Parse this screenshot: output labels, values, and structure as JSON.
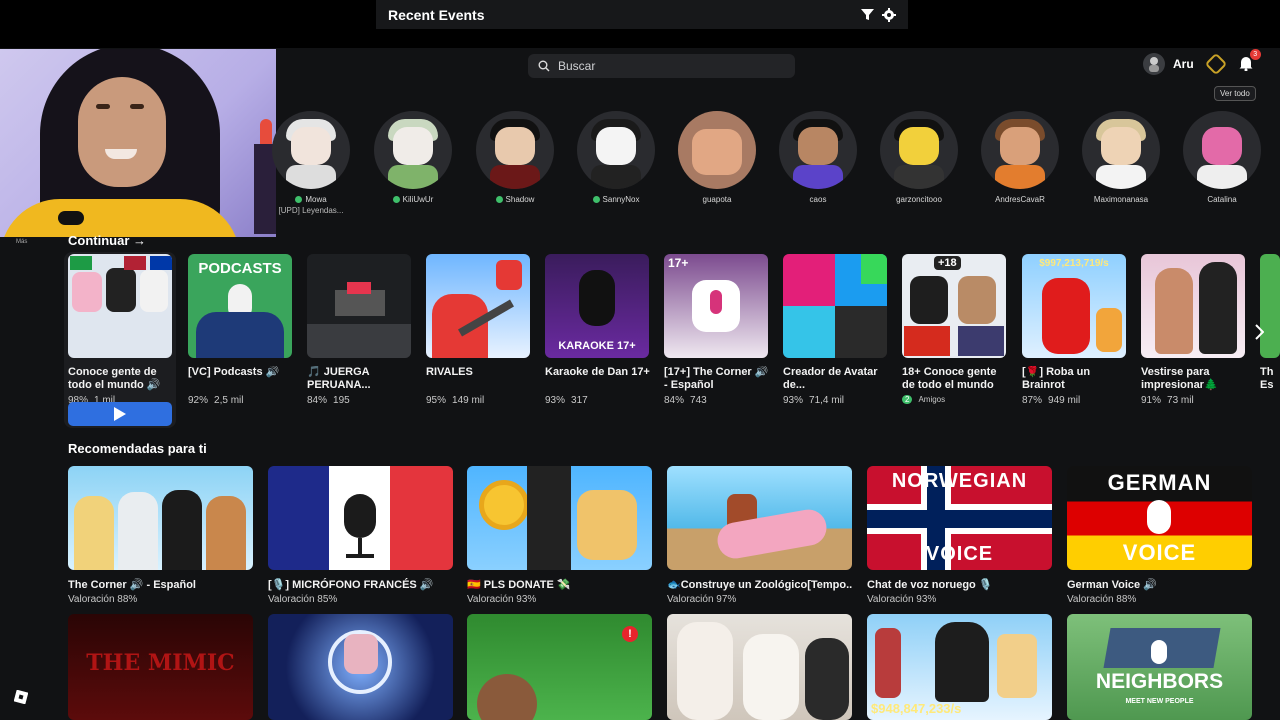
{
  "events_bar": {
    "title": "Recent Events"
  },
  "webcam": {
    "label": "Más"
  },
  "search": {
    "placeholder": "Buscar"
  },
  "user": {
    "name": "Aru",
    "notifications": "3",
    "see_all": "Ver todo"
  },
  "friends": [
    {
      "name": "Mowa",
      "online": true,
      "sub": "[UPD] Leyendas..."
    },
    {
      "name": "KiliUwUr",
      "online": true,
      "sub": ""
    },
    {
      "name": "Shadow",
      "online": true,
      "sub": ""
    },
    {
      "name": "SannyNox",
      "online": true,
      "sub": ""
    },
    {
      "name": "guapota",
      "online": false,
      "sub": ""
    },
    {
      "name": "caos",
      "online": false,
      "sub": ""
    },
    {
      "name": "garzoncitooo",
      "online": false,
      "sub": ""
    },
    {
      "name": "AndresCavaR",
      "online": false,
      "sub": ""
    },
    {
      "name": "Maximonanasa",
      "online": false,
      "sub": ""
    },
    {
      "name": "Catalina",
      "online": false,
      "sub": ""
    }
  ],
  "continue": {
    "title": "Continuar →",
    "games": [
      {
        "title": "Conoce gente de todo el mundo 🔊",
        "rating": "98%",
        "players": "1 mil"
      },
      {
        "title": "[VC] Podcasts 🔊",
        "rating": "92%",
        "players": "2,5 mil",
        "thumb_text": "PODCASTS"
      },
      {
        "title": "🎵 JUERGA PERUANA...",
        "rating": "84%",
        "players": "195"
      },
      {
        "title": "RIVALES",
        "rating": "95%",
        "players": "149 mil"
      },
      {
        "title": "Karaoke de Dan 17+",
        "rating": "93%",
        "players": "317",
        "thumb_text": "KARAOKE 17+"
      },
      {
        "title": "[17+] The Corner 🔊 - Español",
        "rating": "84%",
        "players": "743",
        "thumb_text": "17+"
      },
      {
        "title": "Creador de Avatar de...",
        "rating": "93%",
        "players": "71,4 mil"
      },
      {
        "title": "18+ Conoce gente de todo el mundo",
        "friends_count": "2",
        "friends_label": "Amigos",
        "thumb_text": "+18"
      },
      {
        "title": "[🌹] Roba un Brainrot",
        "rating": "87%",
        "players": "949 mil",
        "thumb_text": "$997,213,719/s"
      },
      {
        "title": "Vestirse para impresionar🌲",
        "rating": "91%",
        "players": "73 mil"
      },
      {
        "title": "Th Es",
        "rating": "",
        "players": ""
      }
    ]
  },
  "recommended": {
    "title": "Recomendadas para ti",
    "games": [
      {
        "title": "The Corner 🔊 - Español",
        "rating": "Valoración 88%"
      },
      {
        "title": "[🎙️] MICRÓFONO FRANCÉS 🔊",
        "rating": "Valoración 85%"
      },
      {
        "title": "🇪🇸 PLS DONATE 💸",
        "rating": "Valoración 93%"
      },
      {
        "title": "🐟Construye un Zoológico[Tempo...",
        "rating": "Valoración 97%"
      },
      {
        "title": "Chat de voz noruego 🎙️",
        "rating": "Valoración 93%",
        "thumb_top": "NORWEGIAN",
        "thumb_bottom": "VOICE"
      },
      {
        "title": "German Voice 🔊",
        "rating": "Valoración 88%",
        "thumb_top": "GERMAN",
        "thumb_bottom": "VOICE"
      }
    ]
  },
  "row3": [
    {
      "thumb_text": "THE MIMIC"
    },
    {
      "thumb_text": ""
    },
    {
      "thumb_text": ""
    },
    {
      "thumb_text": ""
    },
    {
      "thumb_text": "$948,847,233/s"
    },
    {
      "thumb_text": "NEIGHBORS",
      "thumb_sub": "MEET NEW PEOPLE"
    }
  ]
}
